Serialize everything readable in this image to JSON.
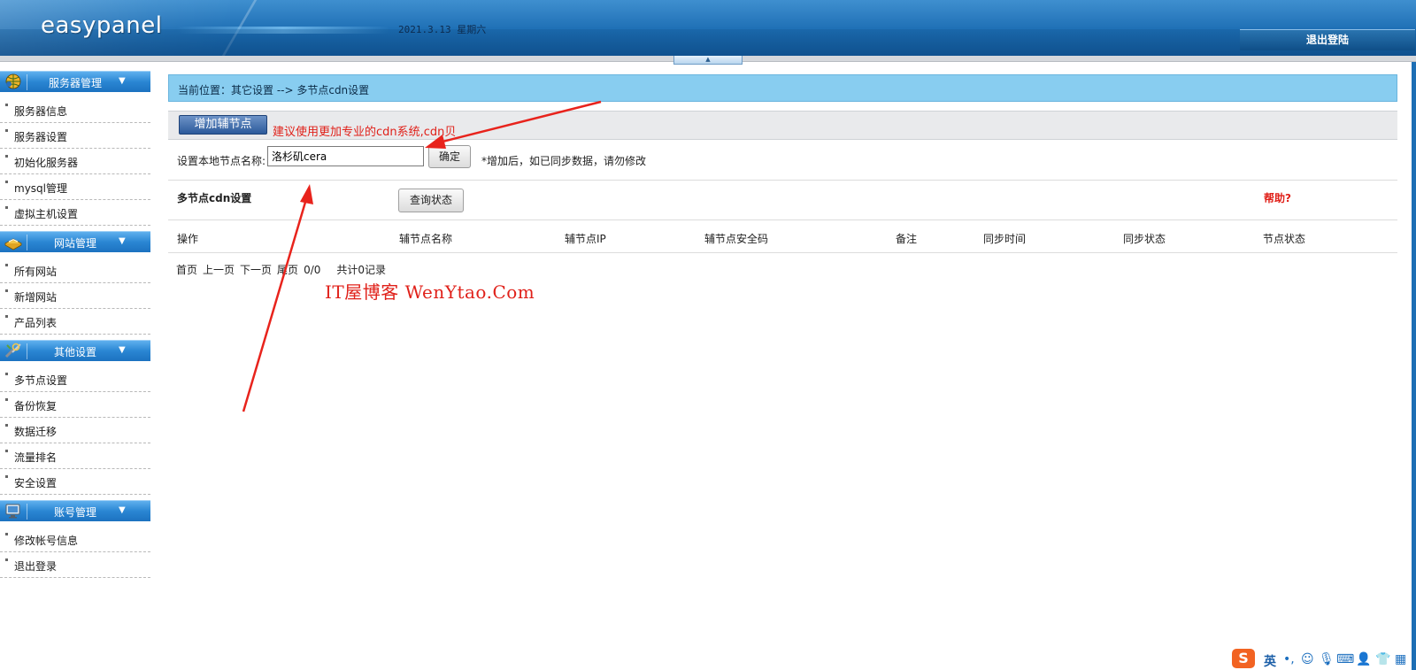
{
  "header": {
    "logo": "easypanel",
    "date": "2021.3.13 星期六",
    "logout": "退出登陆",
    "collapse_glyph": "▲"
  },
  "sidebar": {
    "sections": [
      {
        "title": "服务器管理",
        "icon": "server-globe-icon",
        "items": [
          "服务器信息",
          "服务器设置",
          "初始化服务器",
          "mysql管理",
          "虚拟主机设置"
        ]
      },
      {
        "title": "网站管理",
        "icon": "book-icon",
        "items": [
          "所有网站",
          "新增网站",
          "产品列表"
        ]
      },
      {
        "title": "其他设置",
        "icon": "tools-icon",
        "items": [
          "多节点设置",
          "备份恢复",
          "数据迁移",
          "流量排名",
          "安全设置"
        ]
      },
      {
        "title": "账号管理",
        "icon": "monitor-icon",
        "items": [
          "修改帐号信息",
          "退出登录"
        ]
      }
    ]
  },
  "main": {
    "breadcrumb": "当前位置：其它设置 --> 多节点cdn设置",
    "toolbar": {
      "add_button": "增加辅节点",
      "note": "建议使用更加专业的cdn系统,cdn贝"
    },
    "node_form": {
      "label": "设置本地节点名称:",
      "value": "洛杉矶cera",
      "confirm": "确定",
      "hint": "*增加后，如已同步数据，请勿修改"
    },
    "section": {
      "title": "多节点cdn设置",
      "query_button": "查询状态",
      "help": "帮助?"
    },
    "table": {
      "columns": [
        "操作",
        "辅节点名称",
        "辅节点IP",
        "辅节点安全码",
        "备注",
        "同步时间",
        "同步状态",
        "节点状态"
      ]
    },
    "pager": {
      "first": "首页",
      "prev": "上一页",
      "next": "下一页",
      "last": "尾页",
      "pages": "0/0",
      "total": "共计0记录"
    },
    "watermark": "IT屋博客 WenYtao.Com"
  },
  "ime": {
    "logo": "S",
    "mode": "英",
    "icons": [
      "punctuation-icon",
      "emoji-icon",
      "microphone-icon",
      "keyboard-icon",
      "user-icon",
      "shirt-icon",
      "grid-icon"
    ]
  },
  "colors": {
    "header_blue": "#1d6eb4",
    "breadcrumb_bg": "#88cdf0",
    "accent_red": "#e0211a",
    "button_blue": "#2c5a9b"
  }
}
